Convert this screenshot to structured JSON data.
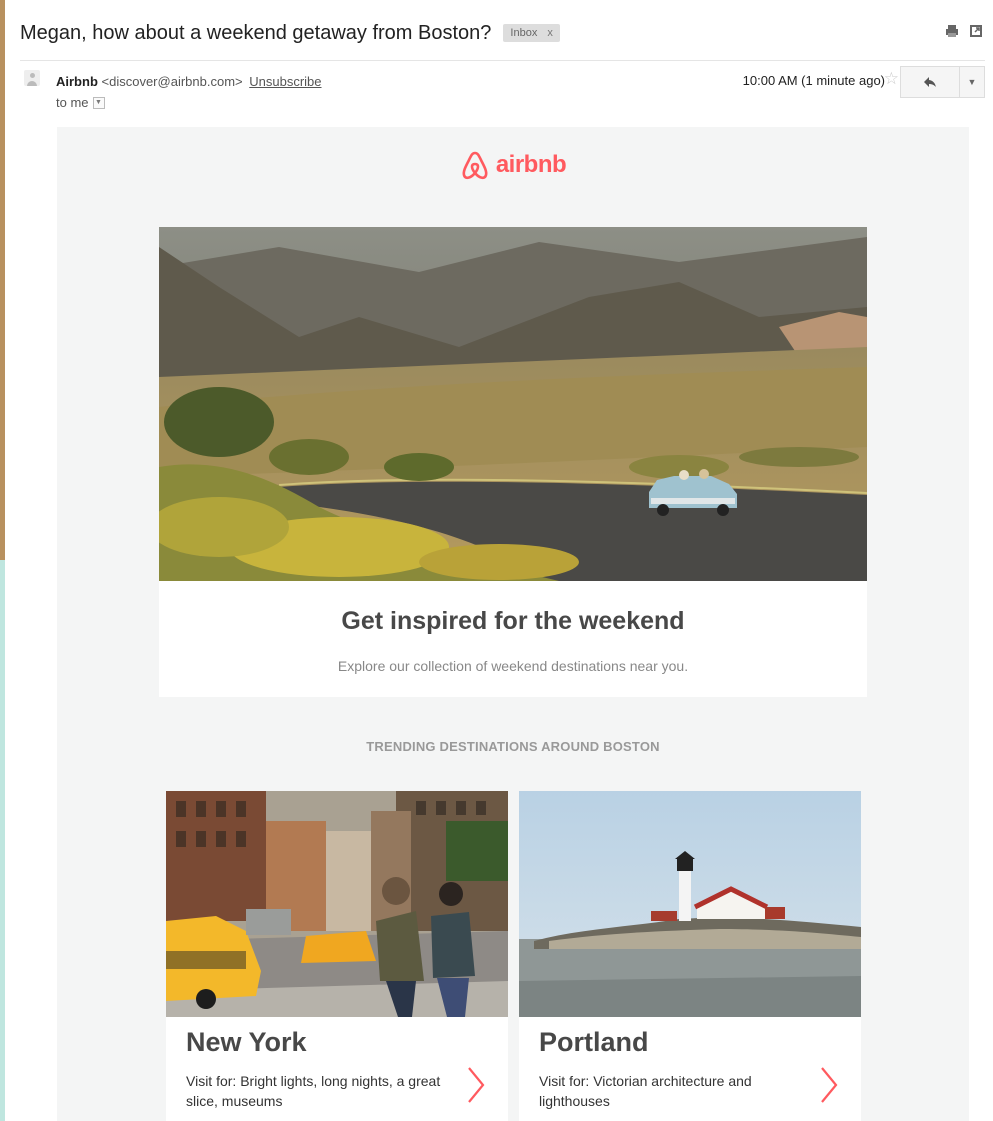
{
  "email": {
    "subject": "Megan, how about a weekend getaway from Boston?",
    "label": "Inbox",
    "label_close": "x",
    "sender_name": "Airbnb",
    "sender_address": "<discover@airbnb.com>",
    "unsubscribe": "Unsubscribe",
    "recipient": "to me",
    "time": "10:00 AM (1 minute ago)"
  },
  "content": {
    "brand": "airbnb",
    "hero_title": "Get inspired for the weekend",
    "hero_subtitle": "Explore our collection of weekend destinations near you.",
    "trending_heading": "TRENDING DESTINATIONS AROUND BOSTON",
    "destinations": [
      {
        "name": "New York",
        "description": "Visit for: Bright lights, long nights, a great slice, museums"
      },
      {
        "name": "Portland",
        "description": "Visit for: Victorian architecture and lighthouses"
      }
    ]
  },
  "icons": {
    "print": "print-icon",
    "popout": "new-window-icon",
    "star": "star-icon",
    "reply": "reply-icon",
    "more": "chevron-down-icon",
    "avatar": "avatar-icon",
    "logo": "airbnb-logo-icon",
    "arrow": "chevron-right-icon"
  },
  "colors": {
    "brand": "#ff5a5f",
    "heading": "#484848",
    "muted": "#888888",
    "body_bg": "#f4f5f5"
  }
}
